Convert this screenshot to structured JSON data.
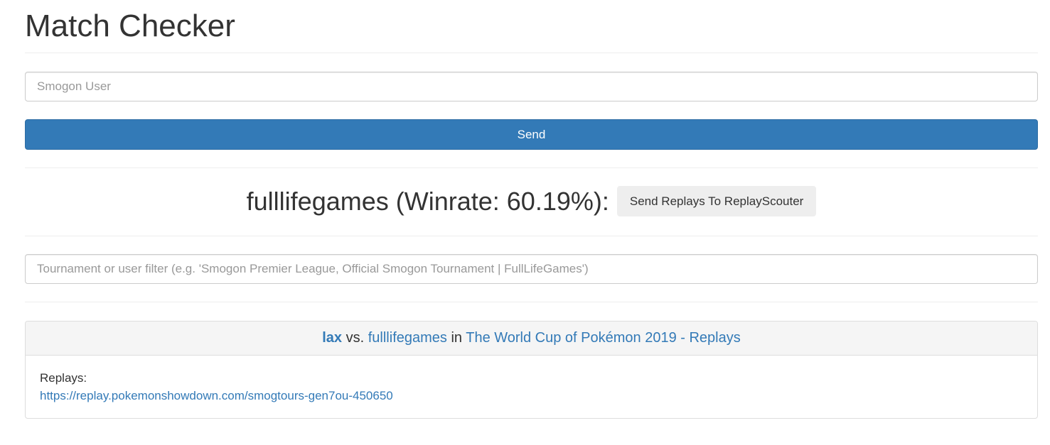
{
  "header": {
    "title": "Match Checker"
  },
  "search": {
    "placeholder": "Smogon User",
    "value": "",
    "send_label": "Send"
  },
  "summary": {
    "user": "fulllifegames",
    "winrate_text": "fulllifegames (Winrate: 60.19%):",
    "winrate": "60.19%",
    "scouter_button_label": "Send Replays To ReplayScouter"
  },
  "filter": {
    "placeholder": "Tournament or user filter (e.g. 'Smogon Premier League, Official Smogon Tournament | FullLifeGames')",
    "value": ""
  },
  "matches": [
    {
      "player1": "lax",
      "vs_text": " vs. ",
      "player2": "fulllifegames",
      "in_text": " in ",
      "tournament": "The World Cup of Pokémon 2019 - Replays",
      "replays_label": "Replays:",
      "replays": [
        "https://replay.pokemonshowdown.com/smogtours-gen7ou-450650"
      ]
    }
  ],
  "colors": {
    "primary": "#337ab7",
    "button_default": "#eeeeee",
    "panel_heading": "#f5f5f5",
    "text": "#333333",
    "placeholder": "#999999"
  }
}
